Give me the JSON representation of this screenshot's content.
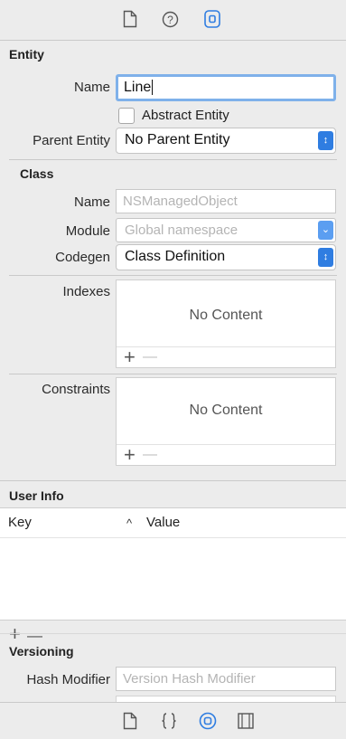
{
  "toolbar_top": {
    "icons": [
      "file-inspector-icon",
      "quick-help-icon",
      "data-model-inspector-icon"
    ],
    "accent": "#2f7de1"
  },
  "entity": {
    "section_title": "Entity",
    "name_label": "Name",
    "name_value": "Line",
    "abstract_label": "Abstract Entity",
    "abstract_checked": false,
    "parent_label": "Parent Entity",
    "parent_value": "No Parent Entity"
  },
  "class": {
    "section_title": "Class",
    "name_label": "Name",
    "name_placeholder": "NSManagedObject",
    "module_label": "Module",
    "module_placeholder": "Global namespace",
    "codegen_label": "Codegen",
    "codegen_value": "Class Definition"
  },
  "indexes": {
    "label": "Indexes",
    "empty_text": "No Content",
    "add": "+",
    "remove": "—"
  },
  "constraints": {
    "label": "Constraints",
    "empty_text": "No Content",
    "add": "+",
    "remove": "—"
  },
  "user_info": {
    "section_title": "User Info",
    "col_key": "Key",
    "sort_indicator": "^",
    "col_value": "Value",
    "add": "+",
    "remove": "—"
  },
  "versioning": {
    "section_title": "Versioning",
    "hash_label": "Hash Modifier",
    "hash_placeholder": "Version Hash Modifier"
  },
  "toolbar_bottom": {
    "icons": [
      "file-template-icon",
      "code-snippet-icon",
      "object-library-icon",
      "media-library-icon"
    ]
  }
}
